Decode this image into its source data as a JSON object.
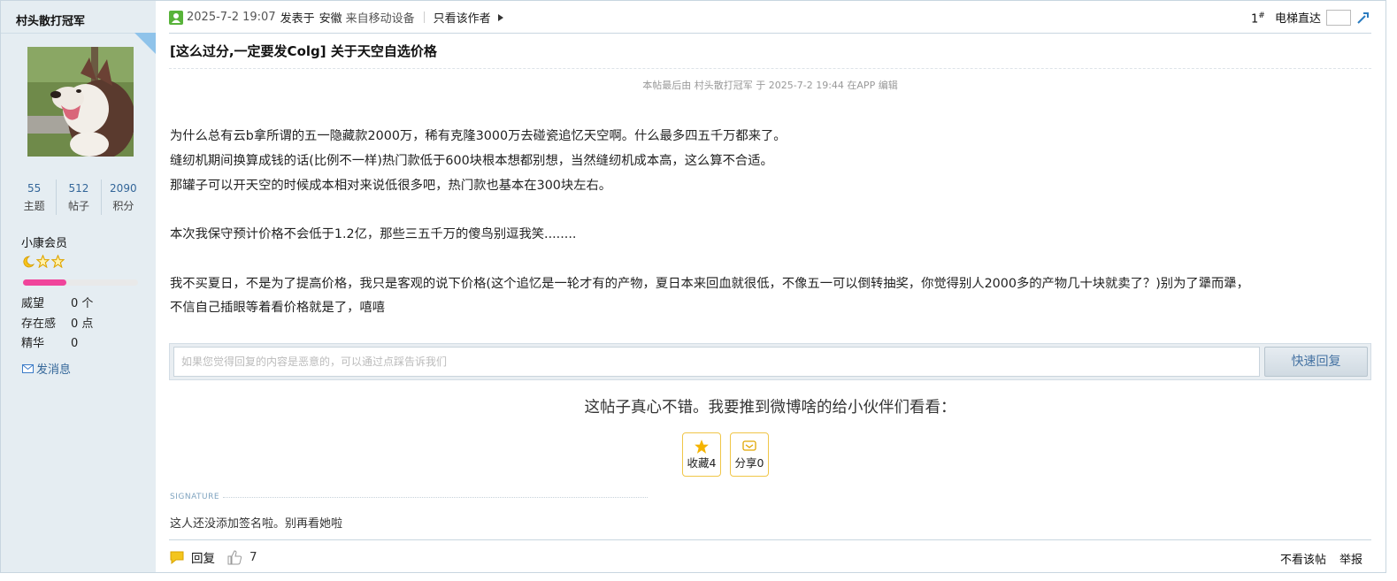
{
  "author": {
    "name": "村头散打冠军",
    "stats": [
      {
        "value": "55",
        "label": "主题"
      },
      {
        "value": "512",
        "label": "帖子"
      },
      {
        "value": "2090",
        "label": "积分"
      }
    ],
    "group": "小康会员",
    "level_progress": 0.38,
    "attributes": [
      {
        "label": "威望",
        "value": "0 个"
      },
      {
        "label": "存在感",
        "value": "0 点"
      },
      {
        "label": "精华",
        "value": "0"
      }
    ],
    "send_message": "发消息",
    "colors": {
      "sidebar_bg": "#e5edf2",
      "link": "#336699",
      "level_bar": "#f0449b"
    }
  },
  "post": {
    "posted_time": "2025-7-2 19:07",
    "posted_in": "发表于",
    "location": "安徽",
    "device": "来自移动设备",
    "only_author": "只看该作者",
    "floor": "1",
    "floor_symbol": "#",
    "elevator": "电梯直达",
    "title": "[这么过分,一定要发Colg] 关于天空自选价格",
    "edited_note": "本帖最后由 村头散打冠军 于 2025-7-2 19:44 在APP 编辑",
    "body": [
      "为什么总有云b拿所谓的五一隐藏款2000万，稀有克隆3000万去碰瓷追忆天空啊。什么最多四五千万都来了。",
      "缝纫机期间换算成钱的话(比例不一样)热门款低于600块根本想都别想，当然缝纫机成本高，这么算不合适。",
      "那罐子可以开天空的时候成本相对来说低很多吧，热门款也基本在300块左右。",
      "本次我保守预计价格不会低于1.2亿，那些三五千万的傻鸟别逗我笑........",
      "我不买夏日，不是为了提高价格，我只是客观的说下价格(这个追忆是一轮才有的产物，夏日本来回血就很低，不像五一可以倒转抽奖，你觉得别人2000多的产物几十块就卖了？)别为了犟而犟，",
      "不信自己插眼等着看价格就是了，嘻嘻"
    ]
  },
  "quick_reply": {
    "placeholder": "如果您觉得回复的内容是恶意的，可以通过点踩告诉我们",
    "button": "快速回复"
  },
  "share": {
    "prompt": "这帖子真心不错。我要推到微博啥的给小伙伴们看看：",
    "favorite_label": "收藏4",
    "share_label": "分享0"
  },
  "signature": {
    "heading": "SIGNATURE",
    "text": "这人还没添加签名啦。别再看她啦"
  },
  "footer": {
    "reply": "回复",
    "like_count": "7",
    "hide_post": "不看该帖",
    "report": "举报"
  },
  "icons": [
    "user-icon",
    "triangle-right-icon",
    "elevator-go-icon",
    "star-icon",
    "envelope-icon",
    "speech-bubble-icon",
    "thumb-up-icon"
  ]
}
